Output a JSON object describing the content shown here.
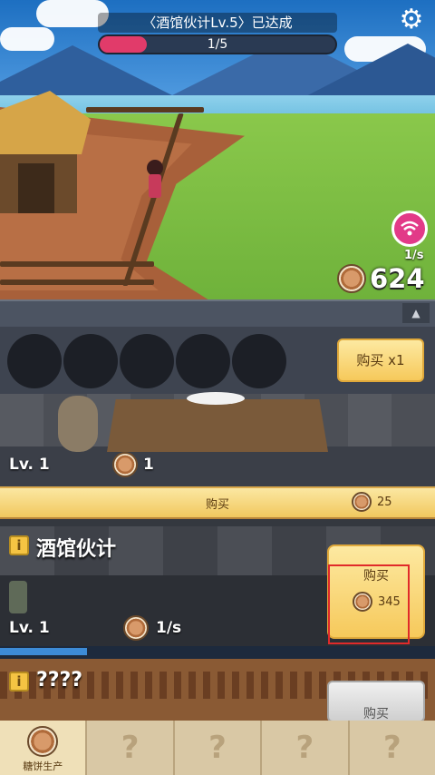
{
  "hud": {
    "quest_title": "〈酒馆伙计Lv.5〉已达成",
    "quest_progress_text": "1/5",
    "quest_progress_fraction": 0.2,
    "settings_icon": "gear-icon"
  },
  "resources": {
    "rate_per_sec": "1/s",
    "cake_total": "624",
    "wifi_icon": "wifi-icon"
  },
  "production": {
    "buy_multiplier_label": "购买 x1",
    "cake_station": {
      "level": "Lv. 1",
      "output": "1",
      "buy_label": "购买",
      "buy_price": "25"
    },
    "worker": {
      "info_badge": "i",
      "name": "酒馆伙计",
      "level": "Lv. 1",
      "rate": "1/s",
      "buy_label": "购买",
      "buy_price": "345",
      "progress_fraction": 0.2
    },
    "locked": {
      "info_badge": "i",
      "name": "????",
      "buy_label": "购买"
    }
  },
  "tabs": [
    {
      "label": "糖饼生产",
      "locked": false
    },
    {
      "label": "?",
      "locked": true
    },
    {
      "label": "?",
      "locked": true
    },
    {
      "label": "?",
      "locked": true
    },
    {
      "label": "?",
      "locked": true
    }
  ],
  "colors": {
    "accent_pink": "#e13b6a",
    "button_yellow": "#f6c95b",
    "highlight_red": "#e02a2a"
  }
}
